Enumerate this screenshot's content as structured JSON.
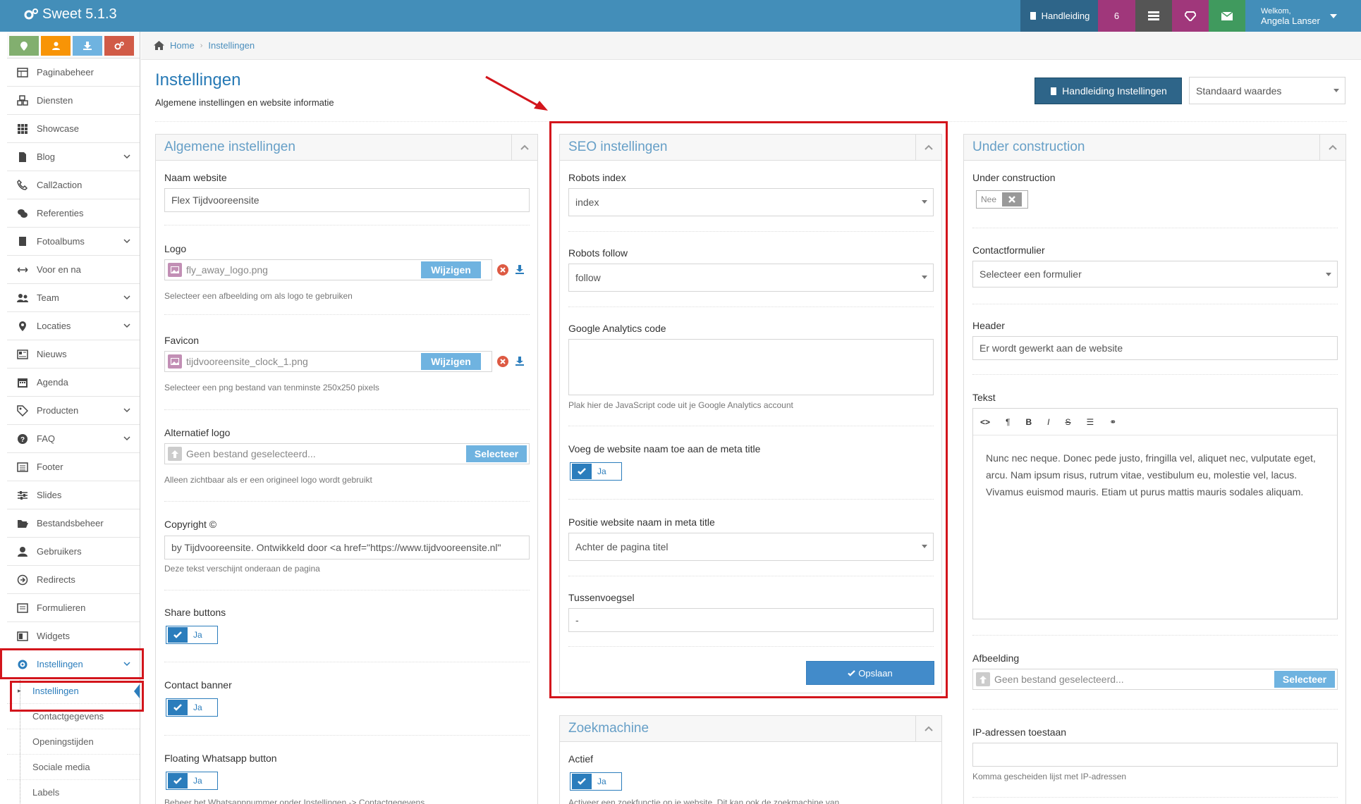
{
  "app": {
    "title": "Sweet 5.1.3"
  },
  "topbar": {
    "help_label": "Handleiding",
    "count": "6",
    "welcome": "Welkom,",
    "user_name": "Angela Lanser"
  },
  "sidebar": {
    "items": [
      {
        "label": "Paginabeheer",
        "icon": "table-icon"
      },
      {
        "label": "Diensten",
        "icon": "cubes-icon"
      },
      {
        "label": "Showcase",
        "icon": "grid-icon"
      },
      {
        "label": "Blog",
        "icon": "file-icon"
      },
      {
        "label": "Call2action",
        "icon": "phone-icon"
      },
      {
        "label": "Referenties",
        "icon": "comments-icon"
      },
      {
        "label": "Fotoalbums",
        "icon": "book-icon"
      },
      {
        "label": "Voor en na",
        "icon": "arrows-h-icon"
      },
      {
        "label": "Team",
        "icon": "users-icon"
      },
      {
        "label": "Locaties",
        "icon": "map-marker-icon"
      },
      {
        "label": "Nieuws",
        "icon": "newspaper-icon"
      },
      {
        "label": "Agenda",
        "icon": "calendar-icon"
      },
      {
        "label": "Producten",
        "icon": "tag-icon"
      },
      {
        "label": "FAQ",
        "icon": "question-icon"
      },
      {
        "label": "Footer",
        "icon": "list-alt-icon"
      },
      {
        "label": "Slides",
        "icon": "sliders-icon"
      },
      {
        "label": "Bestandsbeheer",
        "icon": "folder-open-icon"
      },
      {
        "label": "Gebruikers",
        "icon": "user-icon"
      },
      {
        "label": "Redirects",
        "icon": "arrow-circle-icon"
      },
      {
        "label": "Formulieren",
        "icon": "form-icon"
      },
      {
        "label": "Widgets",
        "icon": "widget-icon"
      },
      {
        "label": "Instellingen",
        "icon": "gear-icon"
      }
    ],
    "subitems": [
      {
        "label": "Instellingen"
      },
      {
        "label": "Contactgegevens"
      },
      {
        "label": "Openingstijden"
      },
      {
        "label": "Sociale media"
      },
      {
        "label": "Labels"
      }
    ]
  },
  "breadcrumb": {
    "home": "Home",
    "current": "Instellingen"
  },
  "page": {
    "title": "Instellingen",
    "subtitle": "Algemene instellingen en website informatie",
    "help_button": "Handleiding Instellingen",
    "preset_select": "Standaard waardes"
  },
  "general": {
    "title": "Algemene instellingen",
    "site_name_label": "Naam website",
    "site_name_value": "Flex Tijdvooreensite",
    "logo_label": "Logo",
    "logo_file": "fly_away_logo.png",
    "change_label": "Wijzigen",
    "logo_help": "Selecteer een afbeelding om als logo te gebruiken",
    "favicon_label": "Favicon",
    "favicon_file": "tijdvooreensite_clock_1.png",
    "favicon_help": "Selecteer een png bestand van tenminste 250x250 pixels",
    "alt_logo_label": "Alternatief logo",
    "alt_logo_placeholder": "Geen bestand geselecteerd...",
    "select_label": "Selecteer",
    "alt_logo_help": "Alleen zichtbaar als er een origineel logo wordt gebruikt",
    "copyright_label": "Copyright ©",
    "copyright_value": "by Tijdvooreensite. Ontwikkeld door <a href=\"https://www.tijdvooreensite.nl\"",
    "copyright_help": "Deze tekst verschijnt onderaan de pagina",
    "share_label": "Share buttons",
    "yes": "Ja",
    "contact_label": "Contact banner",
    "whatsapp_label": "Floating Whatsapp button",
    "whatsapp_help": "Beheer het Whatsappnummer onder Instellingen -> Contactgegevens"
  },
  "seo": {
    "title": "SEO instellingen",
    "robots_index_label": "Robots index",
    "robots_index_value": "index",
    "robots_follow_label": "Robots follow",
    "robots_follow_value": "follow",
    "analytics_label": "Google Analytics code",
    "analytics_help": "Plak hier de JavaScript code uit je Google Analytics account",
    "meta_name_label": "Voeg de website naam toe aan de meta title",
    "yes": "Ja",
    "position_label": "Positie website naam in meta title",
    "position_value": "Achter de pagina titel",
    "separator_label": "Tussenvoegsel",
    "separator_value": "-",
    "save_label": "Opslaan"
  },
  "search": {
    "title": "Zoekmachine",
    "active_label": "Actief",
    "yes": "Ja",
    "help": "Activeer een zoekfunctie op je website. Dit kan ook de zoekmachine van"
  },
  "construction": {
    "title": "Under construction",
    "uc_label": "Under construction",
    "no": "Nee",
    "form_label": "Contactformulier",
    "form_value": "Selecteer een formulier",
    "header_label": "Header",
    "header_value": "Er wordt gewerkt aan de website",
    "text_label": "Tekst",
    "text_body": "Nunc nec neque. Donec pede justo, fringilla vel, aliquet nec, vulputate eget, arcu. Nam ipsum risus, rutrum vitae, vestibulum eu, molestie vel, lacus. Vivamus euismod mauris. Etiam ut purus mattis mauris sodales aliquam.",
    "image_label": "Afbeelding",
    "image_placeholder": "Geen bestand geselecteerd...",
    "select_label": "Selecteer",
    "ip_label": "IP-adressen toestaan",
    "ip_help": "Komma gescheiden lijst met IP-adressen"
  },
  "colors": {
    "topbar": "#438eb9",
    "accent": "#2b7dbc",
    "highlight": "#d3151c"
  }
}
